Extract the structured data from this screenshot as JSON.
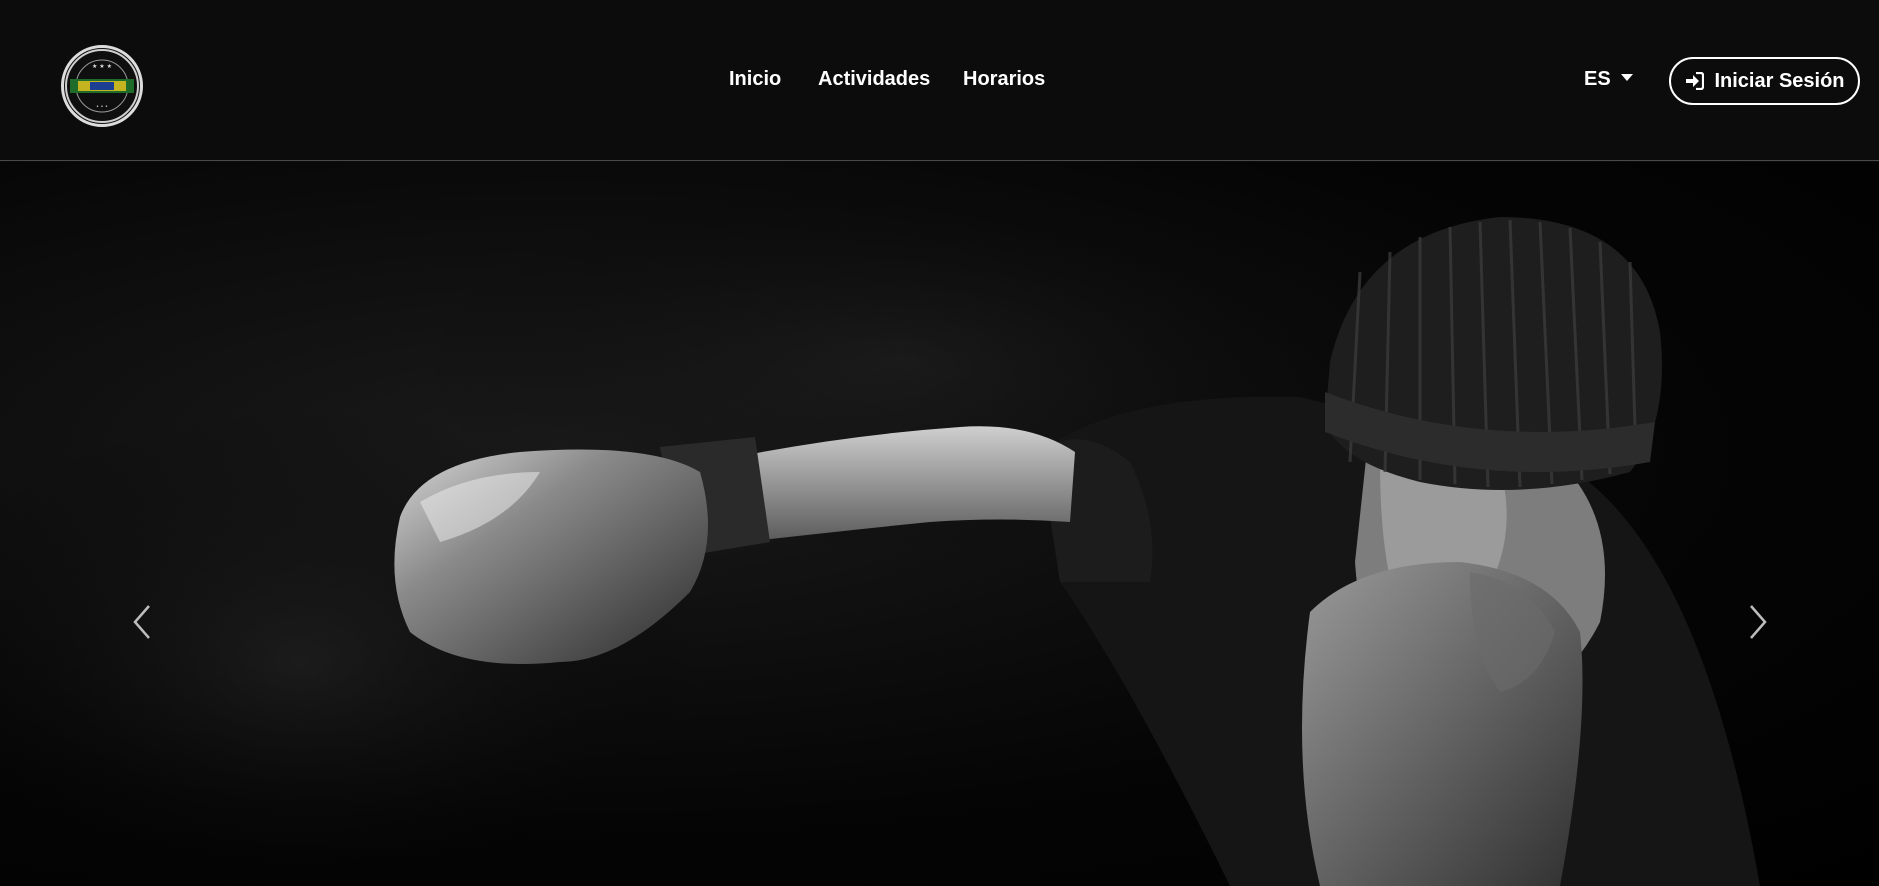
{
  "navbar": {
    "logo_icon": "club-logo-icon",
    "links": [
      {
        "label": "Inicio"
      },
      {
        "label": "Actividades"
      },
      {
        "label": "Horarios"
      }
    ],
    "language": {
      "selected": "ES"
    },
    "login_button": {
      "label": "Iniciar Sesión",
      "icon": "sign-in-icon"
    }
  },
  "hero": {
    "image": "boxer-punching-photo",
    "prev_icon": "chevron-left-icon",
    "next_icon": "chevron-right-icon"
  },
  "colors": {
    "background": "#0c0c0c",
    "text": "#ffffff",
    "divider": "#4a4a4a"
  }
}
